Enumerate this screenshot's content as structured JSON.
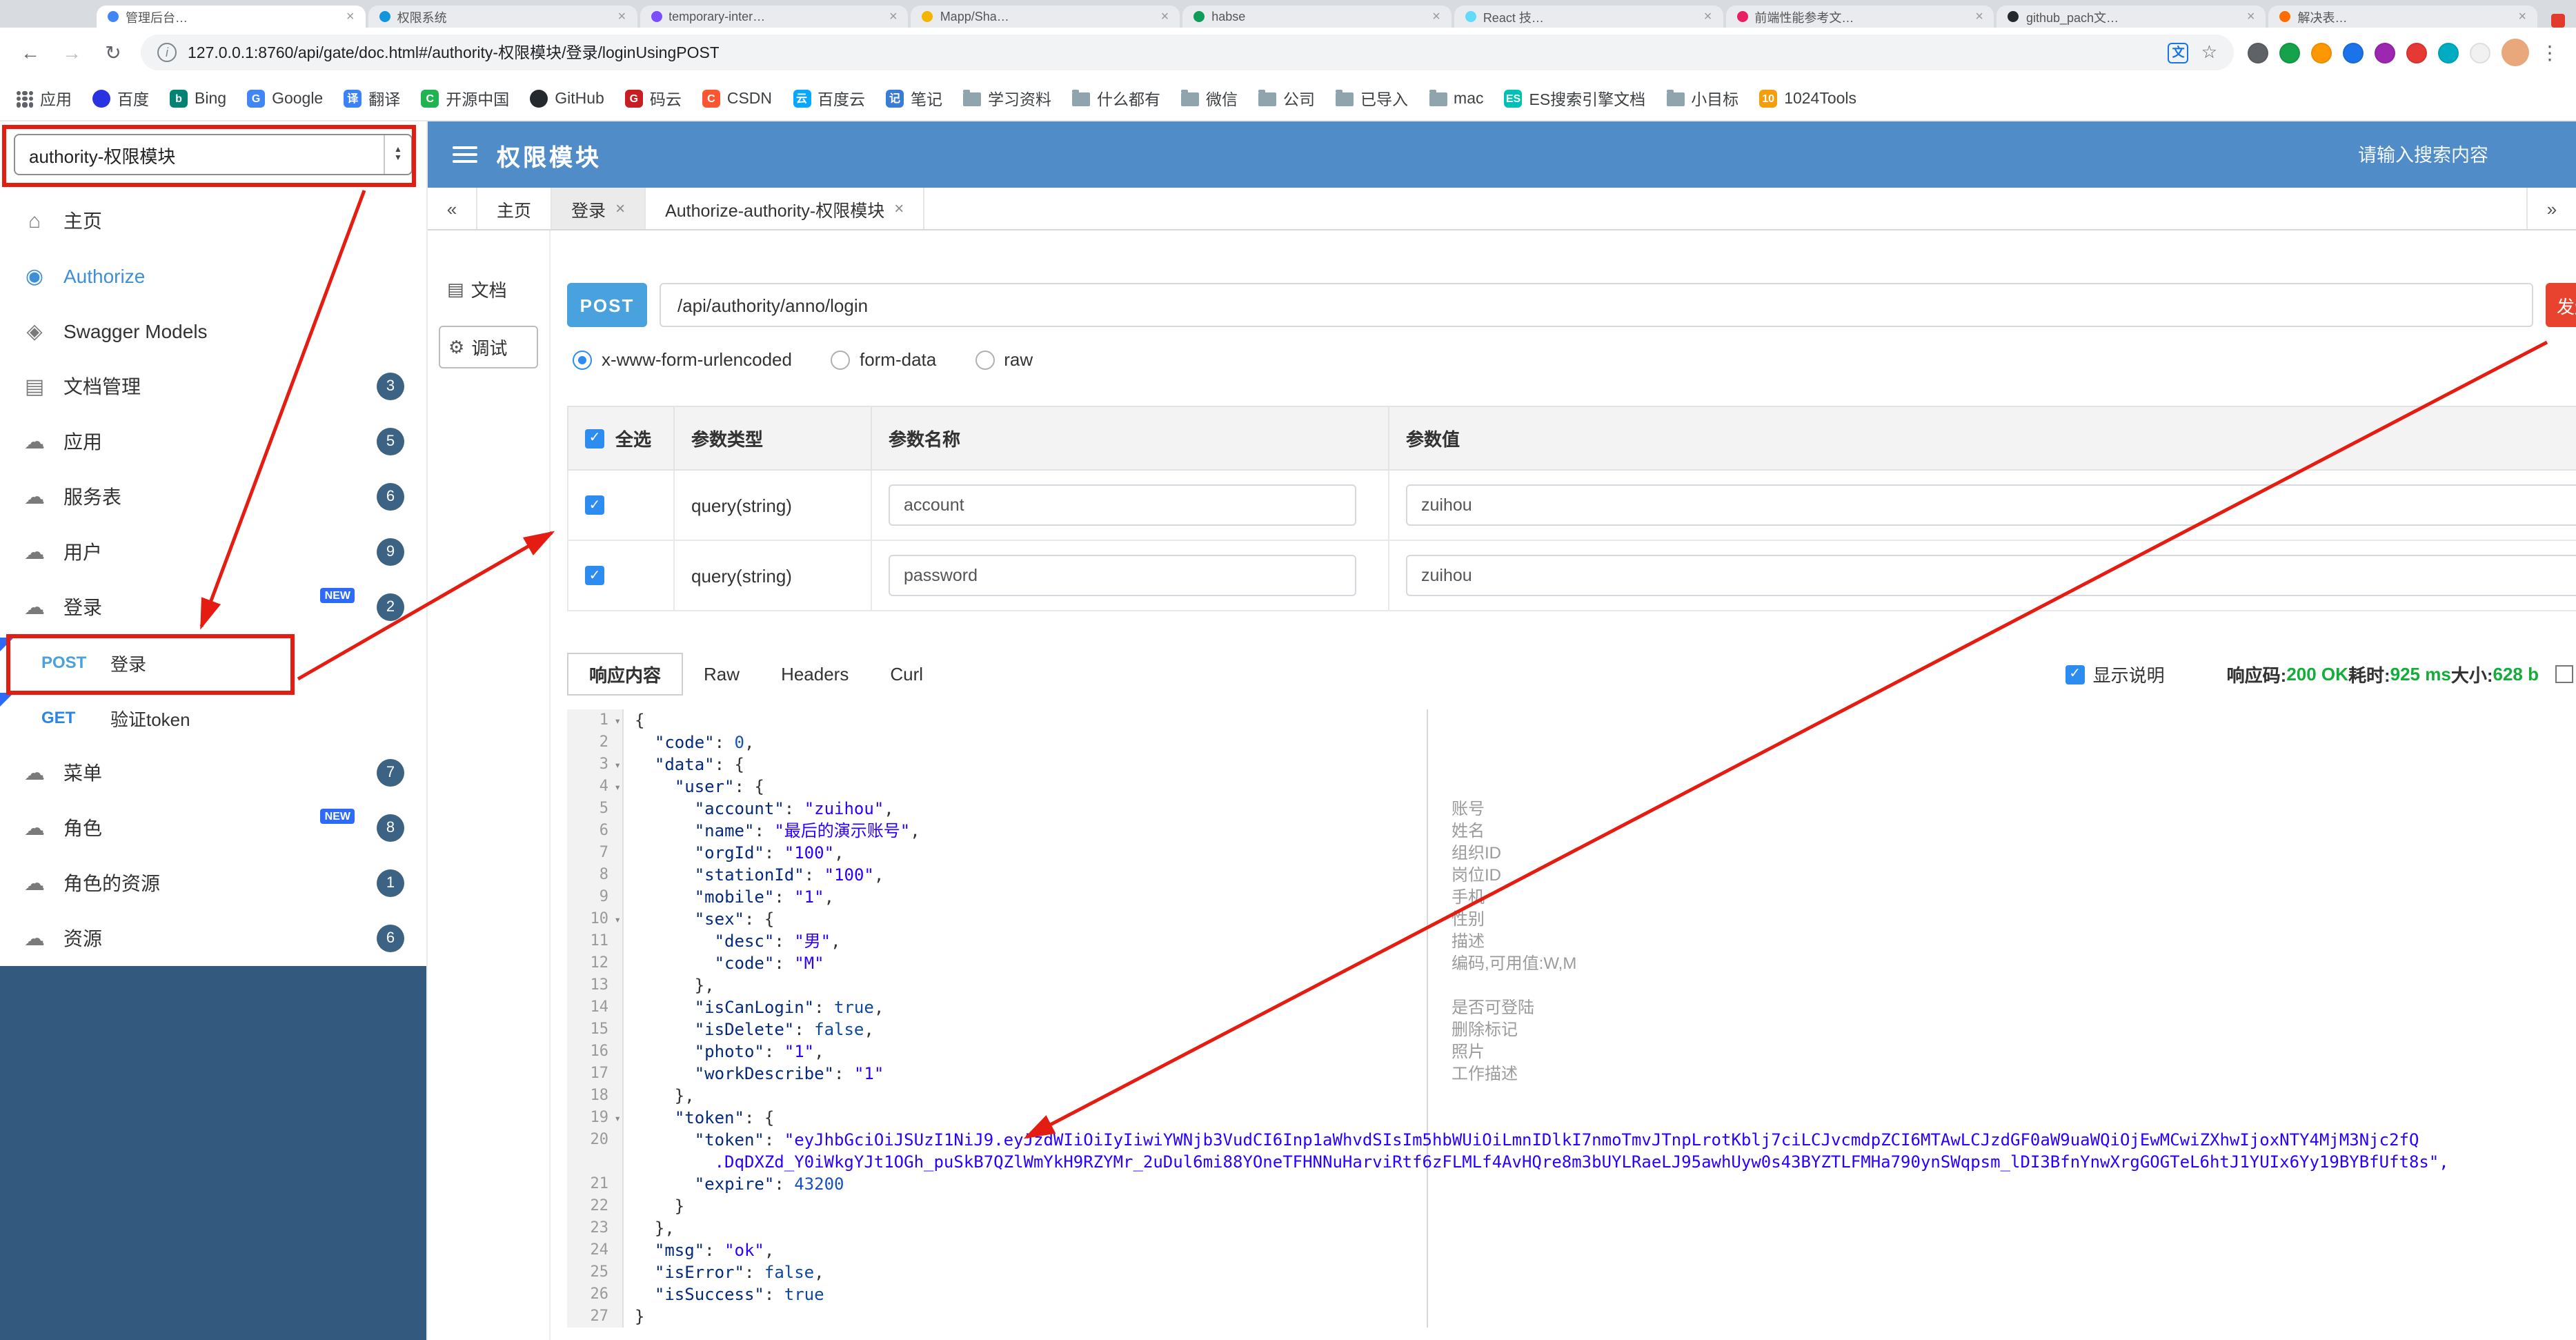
{
  "colors": {
    "header": "#4f8cc8",
    "sidebar_fill": "#33597f",
    "post_badge": "#49a2dd",
    "send_button": "#e7432e",
    "annotation": "#e51c12",
    "count_badge": "#3c6284",
    "new_badge": "#2d6af7",
    "success": "#13ad3a",
    "checkbox": "#2d8cf0"
  },
  "icon_glyphs": {
    "home": "⌂",
    "lock": "◉",
    "models": "◈",
    "doc": "▤",
    "cloud": "☁",
    "debug": "⚙",
    "docpage": "▤",
    "back": "←",
    "forward": "→",
    "reload": "↻",
    "star": "☆",
    "menu": "⋮",
    "info": "i",
    "translate": "文",
    "collapse": "«",
    "expand": "»",
    "select_up": "▲",
    "select_down": "▼"
  },
  "browser": {
    "tabs": [
      {
        "title": "管理后台…",
        "color": "#4285f4"
      },
      {
        "title": "权限系统",
        "color": "#1296db"
      },
      {
        "title": "temporary-inter…",
        "color": "#7c4dff"
      },
      {
        "title": "Mapp/Sha…",
        "color": "#f4b400"
      },
      {
        "title": "habse",
        "color": "#0f9d58"
      },
      {
        "title": "React 技…",
        "color": "#61dafb"
      },
      {
        "title": "前端性能参考文…",
        "color": "#e91e63"
      },
      {
        "title": "github_pach文…",
        "color": "#24292e"
      },
      {
        "title": "解决表…",
        "color": "#ff6d00"
      }
    ],
    "toolbar": {
      "url": "127.0.0.1:8760/api/gate/doc.html#/authority-权限模块/登录/loginUsingPOST",
      "extensions": [
        "#5f6368",
        "#15a24a",
        "#ff9800",
        "#1a73e8",
        "#9c27b0",
        "#e53935",
        "#00acc1",
        "#f1f1f1"
      ]
    },
    "bookmarks": [
      {
        "label": "应用",
        "icon": "apps"
      },
      {
        "label": "百度",
        "icon": "dot",
        "color": "#2932e1"
      },
      {
        "label": "Bing",
        "icon": "letter",
        "letter": "b",
        "color": "#008373"
      },
      {
        "label": "Google",
        "icon": "letter",
        "letter": "G",
        "color": "#4285f4"
      },
      {
        "label": "翻译",
        "icon": "letter",
        "letter": "译",
        "color": "#3b82f6"
      },
      {
        "label": "开源中国",
        "icon": "letter",
        "letter": "C",
        "color": "#21b351"
      },
      {
        "label": "GitHub",
        "icon": "dot",
        "color": "#24292e"
      },
      {
        "label": "码云",
        "icon": "letter",
        "letter": "G",
        "color": "#c71d23"
      },
      {
        "label": "CSDN",
        "icon": "letter",
        "letter": "C",
        "color": "#fc5531"
      },
      {
        "label": "百度云",
        "icon": "letter",
        "letter": "云",
        "color": "#06a7ff"
      },
      {
        "label": "笔记",
        "icon": "letter",
        "letter": "记",
        "color": "#3a7bd5"
      },
      {
        "label": "学习资料",
        "icon": "folder"
      },
      {
        "label": "什么都有",
        "icon": "folder"
      },
      {
        "label": "微信",
        "icon": "folder"
      },
      {
        "label": "公司",
        "icon": "folder"
      },
      {
        "label": "已导入",
        "icon": "folder"
      },
      {
        "label": "mac",
        "icon": "folder"
      },
      {
        "label": "ES搜索引擎文档",
        "icon": "letter",
        "letter": "ES",
        "color": "#00bfb3"
      },
      {
        "label": "小目标",
        "icon": "folder"
      },
      {
        "label": "1024Tools",
        "icon": "letter",
        "letter": "10",
        "color": "#f59e0b"
      }
    ]
  },
  "header": {
    "module_select": "authority-权限模块",
    "title": "权限模块",
    "search_placeholder": "请输入搜索内容"
  },
  "sidebar": {
    "items": [
      {
        "label": "主页",
        "icon": "home"
      },
      {
        "label": "Authorize",
        "icon": "lock",
        "active": true
      },
      {
        "label": "Swagger Models",
        "icon": "models"
      },
      {
        "label": "文档管理",
        "icon": "doc",
        "badge": "3"
      },
      {
        "label": "应用",
        "icon": "cloud",
        "badge": "5"
      },
      {
        "label": "服务表",
        "icon": "cloud",
        "badge": "6"
      },
      {
        "label": "用户",
        "icon": "cloud",
        "badge": "9"
      },
      {
        "label": "登录",
        "icon": "cloud",
        "badge": "2",
        "isNew": true
      },
      {
        "label": "登录",
        "method": "POST",
        "child": true,
        "flagged": true
      },
      {
        "label": "验证token",
        "method": "GET",
        "child": true,
        "flagged": true
      },
      {
        "label": "菜单",
        "icon": "cloud",
        "badge": "7"
      },
      {
        "label": "角色",
        "icon": "cloud",
        "badge": "8",
        "isNew": true
      },
      {
        "label": "角色的资源",
        "icon": "cloud",
        "badge": "1"
      },
      {
        "label": "资源",
        "icon": "cloud",
        "badge": "6"
      }
    ]
  },
  "tabs": {
    "collapse": "«",
    "expand": "»",
    "items": [
      {
        "label": "主页"
      },
      {
        "label": "登录",
        "closable": true,
        "active": true
      },
      {
        "label": "Authorize-authority-权限模块",
        "closable": true
      }
    ]
  },
  "doc_nav": {
    "doc": "文档",
    "debug": "调试"
  },
  "request": {
    "method": "POST",
    "path": "/api/authority/anno/login",
    "send_label": "发送",
    "content_types": [
      {
        "label": "x-www-form-urlencoded",
        "checked": true
      },
      {
        "label": "form-data"
      },
      {
        "label": "raw"
      }
    ]
  },
  "params_table": {
    "headers": {
      "select_all": "全选",
      "type": "参数类型",
      "name": "参数名称",
      "value": "参数值"
    },
    "rows": [
      {
        "checked": true,
        "type": "query(string)",
        "name": "account",
        "value": "zuihou"
      },
      {
        "checked": true,
        "type": "query(string)",
        "name": "password",
        "value": "zuihou"
      }
    ]
  },
  "response": {
    "tabs": [
      "响应内容",
      "Raw",
      "Headers",
      "Curl"
    ],
    "show_desc_label": "显示说明",
    "status_label": "响应码:",
    "status_value": "200 OK",
    "time_label": "耗时:",
    "time_value": "925 ms",
    "size_label": "大小:",
    "size_value": "628 b",
    "code_lines": [
      {
        "n": "1",
        "t": "{",
        "fold": true
      },
      {
        "n": "2",
        "t": "  \"code\": 0,"
      },
      {
        "n": "3",
        "t": "  \"data\": {",
        "fold": true
      },
      {
        "n": "4",
        "t": "    \"user\": {",
        "fold": true
      },
      {
        "n": "5",
        "t": "      \"account\": \"zuihou\",",
        "note": "账号"
      },
      {
        "n": "6",
        "t": "      \"name\": \"最后的演示账号\",",
        "note": "姓名"
      },
      {
        "n": "7",
        "t": "      \"orgId\": \"100\",",
        "note": "组织ID"
      },
      {
        "n": "8",
        "t": "      \"stationId\": \"100\",",
        "note": "岗位ID"
      },
      {
        "n": "9",
        "t": "      \"mobile\": \"1\",",
        "note": "手机"
      },
      {
        "n": "10",
        "t": "      \"sex\": {",
        "fold": true,
        "note": "性别"
      },
      {
        "n": "11",
        "t": "        \"desc\": \"男\",",
        "note": "描述"
      },
      {
        "n": "12",
        "t": "        \"code\": \"M\"",
        "note": "编码,可用值:W,M"
      },
      {
        "n": "13",
        "t": "      },"
      },
      {
        "n": "14",
        "t": "      \"isCanLogin\": true,",
        "note": "是否可登陆"
      },
      {
        "n": "15",
        "t": "      \"isDelete\": false,",
        "note": "删除标记"
      },
      {
        "n": "16",
        "t": "      \"photo\": \"1\",",
        "note": "照片"
      },
      {
        "n": "17",
        "t": "      \"workDescribe\": \"1\"",
        "note": "工作描述"
      },
      {
        "n": "18",
        "t": "    },"
      },
      {
        "n": "19",
        "t": "    \"token\": {",
        "fold": true
      },
      {
        "n": "20",
        "t": "      \"token\": \"eyJhbGciOiJSUzI1NiJ9.eyJzdWIiOiIyIiwiYWNjb3VudCI6Inp1aWhvdSIsIm5hbWUiOiLmnIDlkI7nmoTmvJTnpLrotKblj7ciLCJvcmdpZCI6MTAwLCJzdGF0aW9uaWQiOjEwMCwiZXhwIjoxNTY4MjM3Njc2fQ"
      },
      {
        "n": "",
        "t": "        .DqDXZd_Y0iWkgYJt1OGh_puSkB7QZlWmYkH9RZYMr_2uDul6mi88YOneTFHNNuHarviRtf6zFLMLf4AvHQre8m3bUYLRaeLJ95awhUyw0s43BYZTLFMHa790ynSWqpsm_lDI3BfnYnwXrgGOGTeL6htJ1YUIx6Yy19BYBfUft8s\",",
        "cont": true
      },
      {
        "n": "21",
        "t": "      \"expire\": 43200"
      },
      {
        "n": "22",
        "t": "    }"
      },
      {
        "n": "23",
        "t": "  },"
      },
      {
        "n": "24",
        "t": "  \"msg\": \"ok\","
      },
      {
        "n": "25",
        "t": "  \"isError\": false,"
      },
      {
        "n": "26",
        "t": "  \"isSuccess\": true"
      },
      {
        "n": "27",
        "t": "}"
      }
    ]
  }
}
